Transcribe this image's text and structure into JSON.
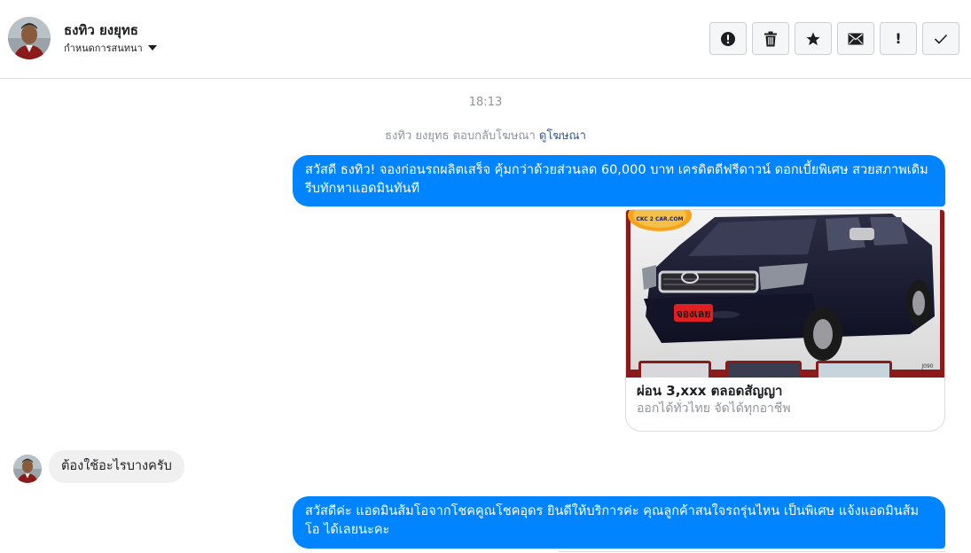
{
  "header": {
    "user_name": "ธงทิว ยงยุทธ",
    "subtitle": "กำหนดการสนทนา",
    "actions": [
      {
        "name": "report-button",
        "icon": "alert-circle-icon"
      },
      {
        "name": "delete-button",
        "icon": "trash-icon"
      },
      {
        "name": "star-button",
        "icon": "star-icon"
      },
      {
        "name": "mark-unread-button",
        "icon": "envelope-icon"
      },
      {
        "name": "spam-button",
        "icon": "exclamation-icon"
      },
      {
        "name": "done-button",
        "icon": "checkmark-icon"
      }
    ]
  },
  "thread": {
    "timestamp": "18:13",
    "reply_note": "ธงทิว ยงยุทธ ตอบกลับโฆษณา",
    "reply_link": "ดูโฆษณา",
    "msg1": "สวัสดี ธงทิว! จองก่อนรถผลิตเสร็จ คุ้มกว่าด้วยส่วนลด 60,000 บาท เครดิตดีฟรีดาวน์ ดอกเบี้ยพิเศษ สวยสภาพเดิม รีบทักหาแอดมินทันที",
    "card": {
      "title": "ผ่อน 3,xxx ตลอดสัญญา",
      "subtitle": "ออกได้ทั่วไทย จัดได้ทุกอาชีพ",
      "badge_logo": "CKC 2 CAR.COM",
      "badge_cta": "จองเลย",
      "watermark": "J090"
    },
    "msg2": "ต้องใช้อะไรบางครับ",
    "msg3": "สวัสดีค่ะ แอดมินส้มโอจากโชคคูณโชคอุดร ยินดีให้บริการค่ะ  คุณลูกค้าสนใจรถรุ่นไหน เป็นพิเศษ แจ้งแอดมินส้มโอ ได้เลยนะคะ"
  },
  "colors": {
    "brand_blue": "#0084ff",
    "incoming_bubble": "#f1f0f0",
    "muted_text": "#90949c",
    "link": "#365899"
  }
}
